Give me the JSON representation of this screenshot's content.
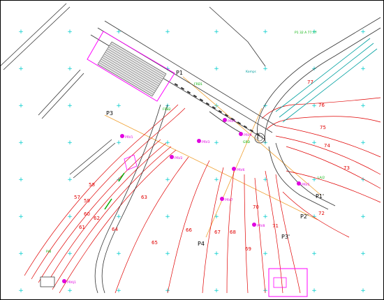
{
  "map": {
    "colors": {
      "background": "#ffffff",
      "grid_cross": "#00cccc",
      "contour": "#e00000",
      "profile_line": "#f0a030",
      "road": "#333333",
      "building_magenta": "#ff00ff",
      "rail_cyan": "#00a0a0",
      "label_black": "#000000",
      "label_green": "#00b000",
      "label_magenta": "#e000e0"
    },
    "profile_labels": [
      "P1",
      "P1'",
      "P2'",
      "P3",
      "P3'",
      "P4"
    ],
    "contour_labels": [
      "57",
      "58",
      "59",
      "60",
      "61",
      "62",
      "63",
      "64",
      "65",
      "66",
      "67",
      "68",
      "69",
      "70",
      "71",
      "72",
      "73",
      "74",
      "75",
      "76",
      "77"
    ],
    "boreholes": [
      "PRV1",
      "PRV2",
      "PRV3",
      "PRV4",
      "PRV5",
      "PRV6",
      "PRV7",
      "PRV8",
      "PRV9",
      "PRAJ1"
    ],
    "green_labels": [
      "P1 32 A  77,77",
      "FRD1",
      "FRB2",
      "GRD",
      "LA/2",
      "P/B"
    ],
    "small_labels": [
      "Kompr."
    ]
  }
}
